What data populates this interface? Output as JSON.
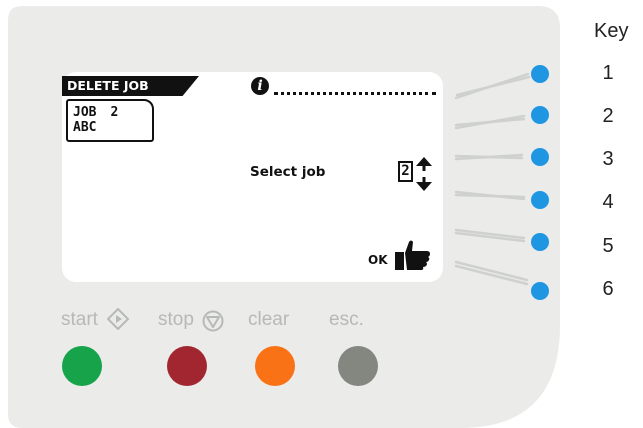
{
  "screen": {
    "title": "DELETE JOB",
    "job_line1_a": "JOB",
    "job_line1_b": "2",
    "job_line2": "ABC",
    "info_icon": "i",
    "select_label": "Select job",
    "job_number": "2",
    "ok_label": "OK"
  },
  "key": {
    "title": "Key",
    "numbers": [
      "1",
      "2",
      "3",
      "4",
      "5",
      "6"
    ]
  },
  "buttons": {
    "start_label": "start",
    "stop_label": "stop",
    "clear_label": "clear",
    "esc_label": "esc."
  },
  "colors": {
    "panel": "#ebebea",
    "soft_key": "#1f96e2",
    "start": "#16a34a",
    "stop": "#a2262f",
    "clear": "#f97316",
    "esc": "#838780"
  },
  "icons": {
    "info": "info-icon",
    "arrows": "up-down-arrows-icon",
    "thumb": "thumbs-up-icon",
    "start": "start-diamond-icon",
    "stop": "stop-triangle-icon"
  }
}
